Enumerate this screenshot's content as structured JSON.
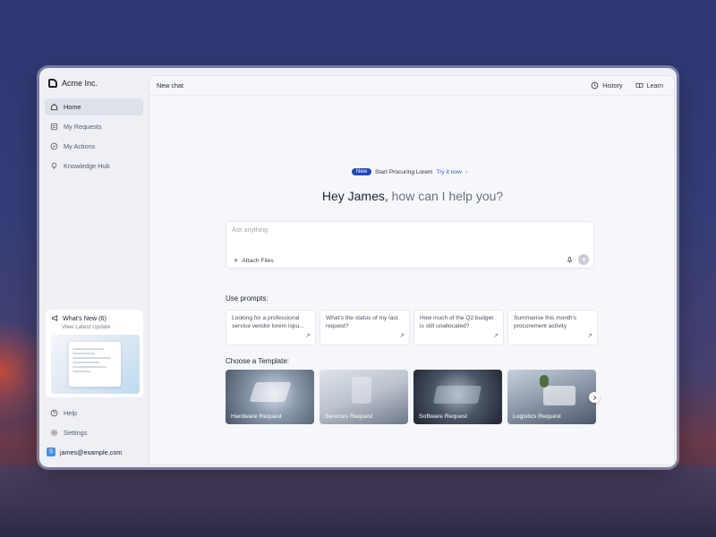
{
  "brand": {
    "name": "Acme Inc."
  },
  "sidebar": {
    "items": [
      {
        "label": "Home",
        "icon": "home-icon",
        "active": true
      },
      {
        "label": "My Requests",
        "icon": "requests-icon"
      },
      {
        "label": "My Actions",
        "icon": "check-circle-icon"
      },
      {
        "label": "Knowledge Hub",
        "icon": "lightbulb-icon"
      }
    ],
    "whats_new": {
      "title": "What's New (6)",
      "subtitle": "View Latest Update"
    },
    "bottom_items": [
      {
        "label": "Help",
        "icon": "help-icon"
      },
      {
        "label": "Settings",
        "icon": "gear-icon"
      }
    ],
    "user": {
      "email": "james@example.com",
      "initial": "S"
    }
  },
  "topbar": {
    "title": "New chat",
    "history_label": "History",
    "learn_label": "Learn"
  },
  "announcement": {
    "badge": "New",
    "text": "Start Procuring Lorem",
    "link": "Try it now"
  },
  "greeting": {
    "name": "Hey James,",
    "question": "how can I help you?"
  },
  "composer": {
    "placeholder": "Ask anything",
    "value": "",
    "attach_label": "Attach Files"
  },
  "prompts": {
    "label": "Use prompts:",
    "items": [
      "Looking for a professional service vendor lorem ispu...",
      "What's the status of my last request?",
      "How much of the Q2 budget is still unallocated?",
      "Summarise this month's procurement activity"
    ]
  },
  "templates": {
    "label": "Choose a Template:",
    "items": [
      {
        "label": "Hardware Request"
      },
      {
        "label": "Services Request"
      },
      {
        "label": "Software Request"
      },
      {
        "label": "Logistics Request"
      }
    ]
  },
  "colors": {
    "accent": "#1f49b8",
    "link": "#2b57c9",
    "avatar": "#4b8fe0"
  }
}
